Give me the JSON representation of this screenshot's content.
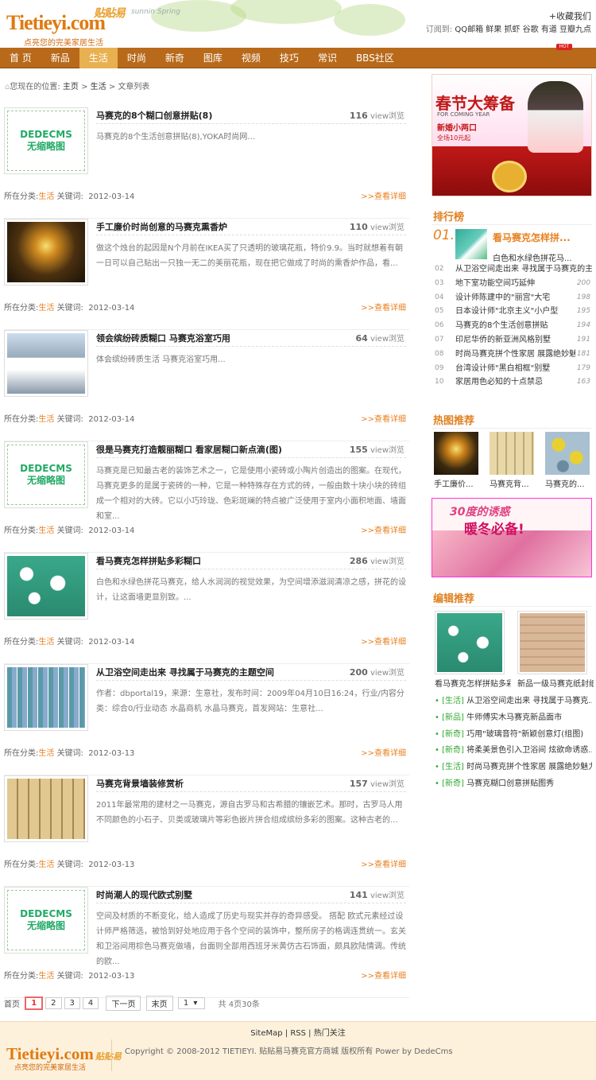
{
  "header": {
    "logo_text": "Tietieyi.com",
    "logo_cn": "贴贴易",
    "slogan": "点亮您的完美家居生活",
    "season_text": "sunnin Spring",
    "favorite": "+收藏我们",
    "subscribe_label": "订阅到:",
    "subscribe_links": "QQ邮箱 鲜果 抓虾 谷歌 有道 豆瓣九点"
  },
  "nav": {
    "items": [
      "首 页",
      "新品",
      "生活",
      "时尚",
      "新奇",
      "图库",
      "视频",
      "技巧",
      "常识",
      "BBS社区"
    ],
    "active_index": 2,
    "hot_badge": "HOT"
  },
  "breadcrumb": {
    "prefix": "您现在的位置:",
    "home": "主页",
    "sep": " > ",
    "section": "生活",
    "page": "文章列表"
  },
  "articles": [
    {
      "title": "马赛克的8个糊口创意拼贴(8)",
      "views": "116",
      "views_unit": "view浏览",
      "desc": "马赛克的8个生活创意拼贴(8),YOKA时尚网...",
      "category": "生活",
      "keyword_label": "关键词:",
      "date": "2012-03-14",
      "has_thumb": false,
      "thumb": "none"
    },
    {
      "title": "手工廉价时尚创意的马赛克熏香炉",
      "views": "110",
      "views_unit": "view浏览",
      "desc": "做这个烛台的起因是N个月前在IKEA买了只透明的玻璃花瓶，特价9.9。当时就想着有朝一日可以自己贴出一只独一无二的美丽花瓶，现在把它做成了时尚的熏香炉作品，看...",
      "category": "生活",
      "keyword_label": "关键词:",
      "date": "2012-03-14",
      "has_thumb": true,
      "thumb": "candle"
    },
    {
      "title": "领会缤纷砖质糊口 马赛克浴室巧用",
      "views": "64",
      "views_unit": "view浏览",
      "desc": "体会缤纷砖质生活 马赛克浴室巧用...",
      "category": "生活",
      "keyword_label": "关键词:",
      "date": "2012-03-14",
      "has_thumb": true,
      "thumb": "bathroom"
    },
    {
      "title": "很是马赛克打造靓丽糊口 看家居糊口新点滴(图)",
      "views": "155",
      "views_unit": "view浏览",
      "desc": "马赛克是已知最古老的装饰艺术之一，它是使用小瓷砖或小陶片创造出的图案。在现代，马赛克更多的是属于瓷砖的一种，它是一种特殊存在方式的砖，一般由数十块小块的砖组成一个相对的大砖。它以小巧玲珑、色彩斑斓的特点被广泛使用于室内小面积地面、墙面和室...",
      "category": "生活",
      "keyword_label": "关键词:",
      "date": "2012-03-14",
      "has_thumb": false,
      "thumb": "none"
    },
    {
      "title": "看马赛克怎样拼贴多彩糊口",
      "views": "286",
      "views_unit": "view浏览",
      "desc": "白色和水绿色拼花马赛克，给人水润润的视觉效果，为空间增添滋润清凉之感，拼花的设计，让这面墙更显别致。...",
      "category": "生活",
      "keyword_label": "关键词:",
      "date": "2012-03-14",
      "has_thumb": true,
      "thumb": "floral"
    },
    {
      "title": "从卫浴空间走出来 寻找属于马赛克的主题空间",
      "views": "200",
      "views_unit": "view浏览",
      "desc": "作者：dbportal19，来源：生意社，发布时间：2009年04月10日16:24，行业/内容分类：综合0/行业动态 水晶商机 水晶马赛克，首发网站：生意社...",
      "category": "生活",
      "keyword_label": "关键词:",
      "date": "2012-03-13",
      "has_thumb": true,
      "thumb": "tiles"
    },
    {
      "title": "马赛克背景墙装修赏析",
      "views": "157",
      "views_unit": "view浏览",
      "desc": "2011年最常用的建材之一马赛克，源自古罗马和古希腊的镶嵌艺术。那时，古罗马人用不同颜色的小石子、贝类或玻璃片等彩色嵌片拼合组成缤纷多彩的图案。这种古老的...",
      "category": "生活",
      "keyword_label": "关键词:",
      "date": "2012-03-13",
      "has_thumb": true,
      "thumb": "wall"
    },
    {
      "title": "时尚潮人的现代欧式别墅",
      "views": "141",
      "views_unit": "view浏览",
      "desc": "空间及材质的不断变化，给人造成了历史与现实并存的奇异感受。 搭配 欧式元素经过设计师严格筛选，被恰到好处地应用于各个空间的装饰中，整所房子的格调连贯统一。玄关和卫浴间用棕色马赛克做墙，台面则全部用西班牙米黄仿古石饰面，颇具欧陆情调。传统的欧...",
      "category": "生活",
      "keyword_label": "关键词:",
      "date": "2012-03-13",
      "has_thumb": false,
      "thumb": "none"
    }
  ],
  "article_common": {
    "category_label": "所在分类:",
    "more": ">>查看详细",
    "nothumb_line1": "DEDECMS",
    "nothumb_line2": "无缩略图"
  },
  "pager": {
    "first": "首页",
    "pages": [
      "1",
      "2",
      "3",
      "4"
    ],
    "current": "1",
    "next": "下一页",
    "last": "末页",
    "select_value": "1",
    "total": "共 4页30条"
  },
  "sidebar": {
    "banner1": {
      "title": "春节大筹备",
      "sub": "FOR COMING YEAR",
      "tag": "新婚小两口",
      "price": "全场10元起"
    },
    "ranking_title": "排行榜",
    "top": {
      "num": "01.",
      "title": "看马赛克怎样拼...",
      "sub": "白色和水绿色拼花马..."
    },
    "ranking": [
      {
        "num": "02",
        "title": "从卫浴空间走出来 寻找属于马赛克的主题",
        "views": ""
      },
      {
        "num": "03",
        "title": "地下室功能空间巧延伸",
        "views": "200"
      },
      {
        "num": "04",
        "title": "设计师陈建中的\"丽宫\"大宅",
        "views": "198"
      },
      {
        "num": "05",
        "title": "日本设计师\"北京主义\"小户型",
        "views": "195"
      },
      {
        "num": "06",
        "title": "马赛克的8个生活创意拼贴",
        "views": "194"
      },
      {
        "num": "07",
        "title": "印尼华侨的新亚洲风格别墅",
        "views": "191"
      },
      {
        "num": "08",
        "title": "时尚马赛克拼个性家居 展露绝妙魅力",
        "views": "181"
      },
      {
        "num": "09",
        "title": "台湾设计师\"黑白相框\"别墅",
        "views": "179"
      },
      {
        "num": "10",
        "title": "家居用色必知的十点禁忌",
        "views": "163"
      }
    ],
    "hot_title": "热图推荐",
    "hot_items": [
      "手工廉价...",
      "马赛克背...",
      "马赛克的..."
    ],
    "banner2": {
      "title": "30度的诱惑",
      "sub": "暖冬必备!"
    },
    "editor_title": "编辑推荐",
    "editor_items": [
      "看马赛克怎样拼贴多彩",
      "新品一级马赛克纸封纸"
    ],
    "editor_list": [
      {
        "tag": "[生活]",
        "title": "从卫浴空间走出来 寻找属于马赛克..."
      },
      {
        "tag": "[新品]",
        "title": "牛师傅实木马赛克新品面市"
      },
      {
        "tag": "[新奇]",
        "title": "巧用\"玻璃音符\"新颖创意灯(组图)"
      },
      {
        "tag": "[新奇]",
        "title": "将柔美景色引入卫浴间 炫欲命诱惑..."
      },
      {
        "tag": "[生活]",
        "title": "时尚马赛克拼个性家居 展露绝妙魅力"
      },
      {
        "tag": "[新奇]",
        "title": "马赛克糊口创意拼贴图秀"
      }
    ]
  },
  "footer": {
    "links": "SiteMap | RSS | 热门关注",
    "logo_text": "Tietieyi.com",
    "logo_cn": "贴贴易",
    "slogan": "点亮您的完美家居生活",
    "copyright": "Copyright © 2008-2012 TIETIEYI. 贴贴易马赛克官方商城 版权所有 Power by DedeCms"
  },
  "colors": {
    "nav_bg": "#b86a1a",
    "nav_active": "#e8b050",
    "accent": "#e88020",
    "green_tag": "#33aa33",
    "footer_bg": "#fdf1dc"
  }
}
